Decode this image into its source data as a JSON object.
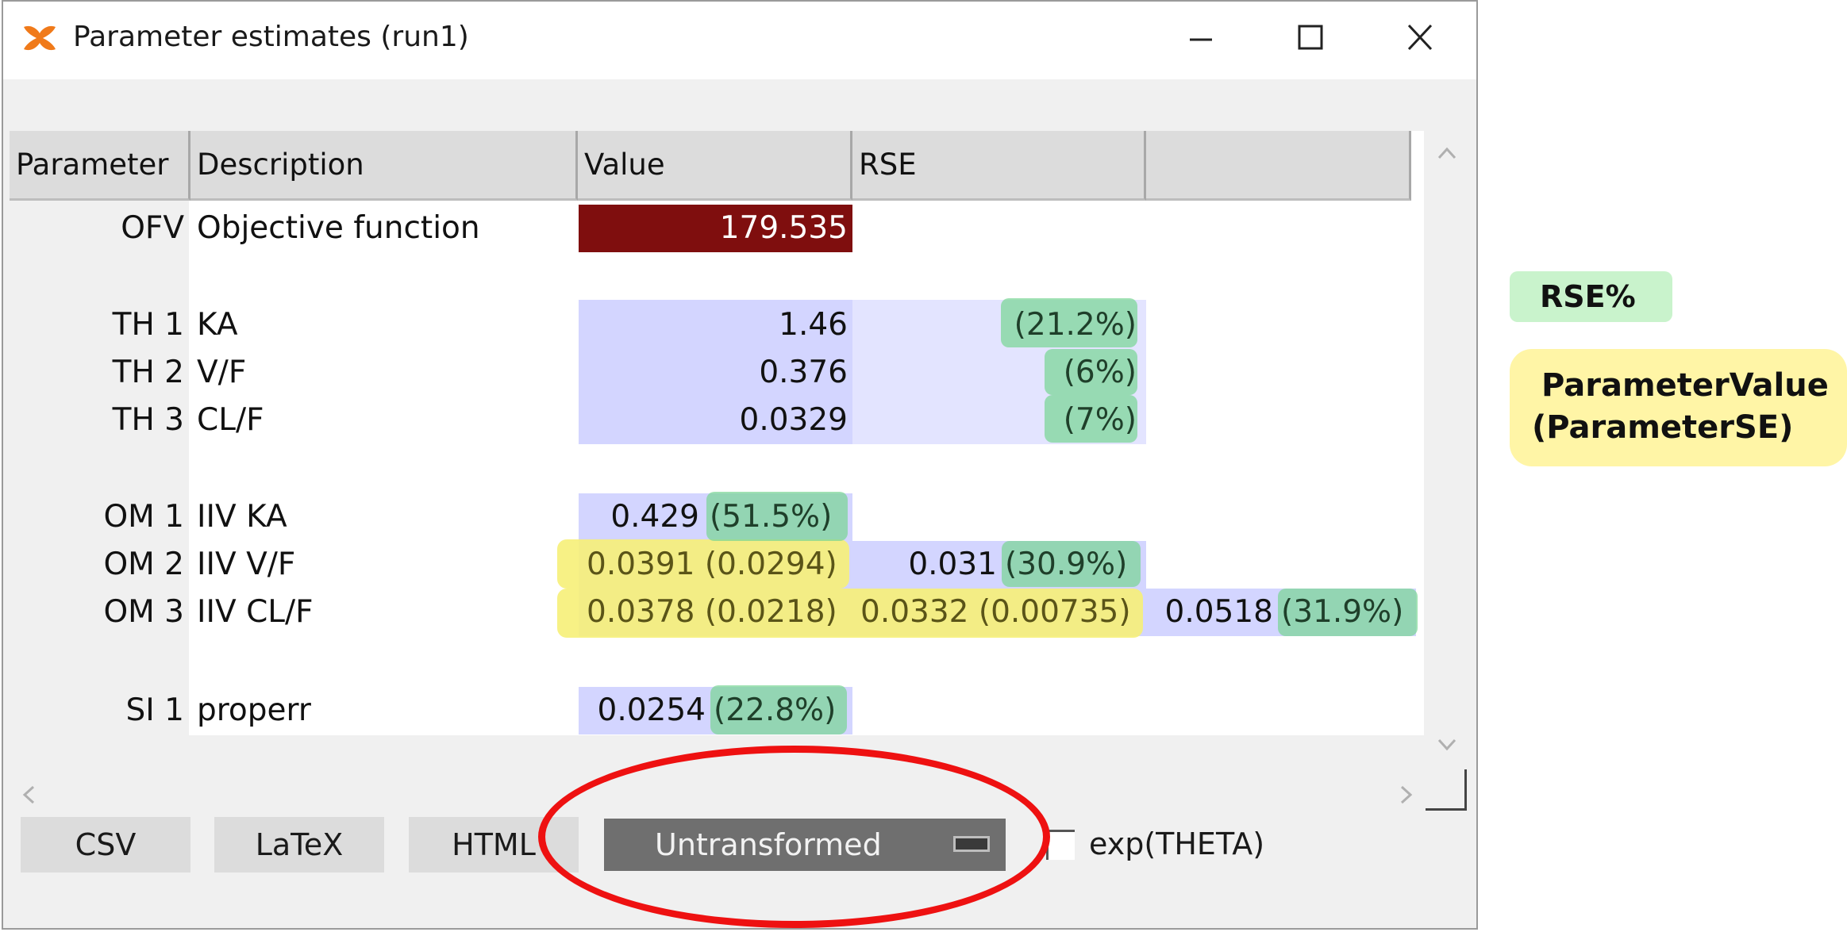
{
  "window": {
    "title": "Parameter estimates (run1)",
    "icon": "app-logo-icon",
    "controls": [
      "minimize-icon",
      "maximize-icon",
      "close-icon"
    ]
  },
  "table": {
    "headers": [
      "Parameter",
      "Description",
      "Value",
      "RSE"
    ],
    "ofv": {
      "param": "OFV",
      "desc": "Objective function",
      "value": "179.535",
      "value_bg": "#7f0e0e"
    },
    "thetas": [
      {
        "param": "TH 1",
        "desc": "KA",
        "value": "1.46",
        "rse": "(21.2%)"
      },
      {
        "param": "TH 2",
        "desc": "V/F",
        "value": "0.376",
        "rse": "(6%)"
      },
      {
        "param": "TH 3",
        "desc": "CL/F",
        "value": "0.0329",
        "rse": "(7%)"
      }
    ],
    "omegas": [
      {
        "param": "OM 1",
        "desc": "IIV KA",
        "cells": [
          "0.429",
          "(51.5%)"
        ]
      },
      {
        "param": "OM 2",
        "desc": "IIV V/F",
        "cells": [
          "0.0391 (0.0294)",
          "0.031",
          "(30.9%)"
        ]
      },
      {
        "param": "OM 3",
        "desc": "IIV CL/F",
        "cells": [
          "0.0378 (0.0218)",
          "0.0332 (0.00735)",
          "0.0518",
          "(31.9%)"
        ]
      }
    ],
    "sigmas": [
      {
        "param": "SI 1",
        "desc": "properr",
        "value": "0.0254",
        "rse": "(22.8%)"
      }
    ]
  },
  "buttons": {
    "csv": "CSV",
    "latex": "LaTeX",
    "html": "HTML"
  },
  "transform_select": {
    "selected": "Untransformed"
  },
  "exp_theta": {
    "label": "exp(THETA)",
    "checked": false
  },
  "legend": {
    "rse": "RSE%",
    "pv_line1": "ParameterValue",
    "pv_line2": "(ParameterSE)"
  },
  "colors": {
    "blue_cell": "#d3d5ff",
    "rse_highlight": "#7ad696",
    "se_highlight": "#f6f078",
    "annotation_circle": "#ee1111"
  }
}
